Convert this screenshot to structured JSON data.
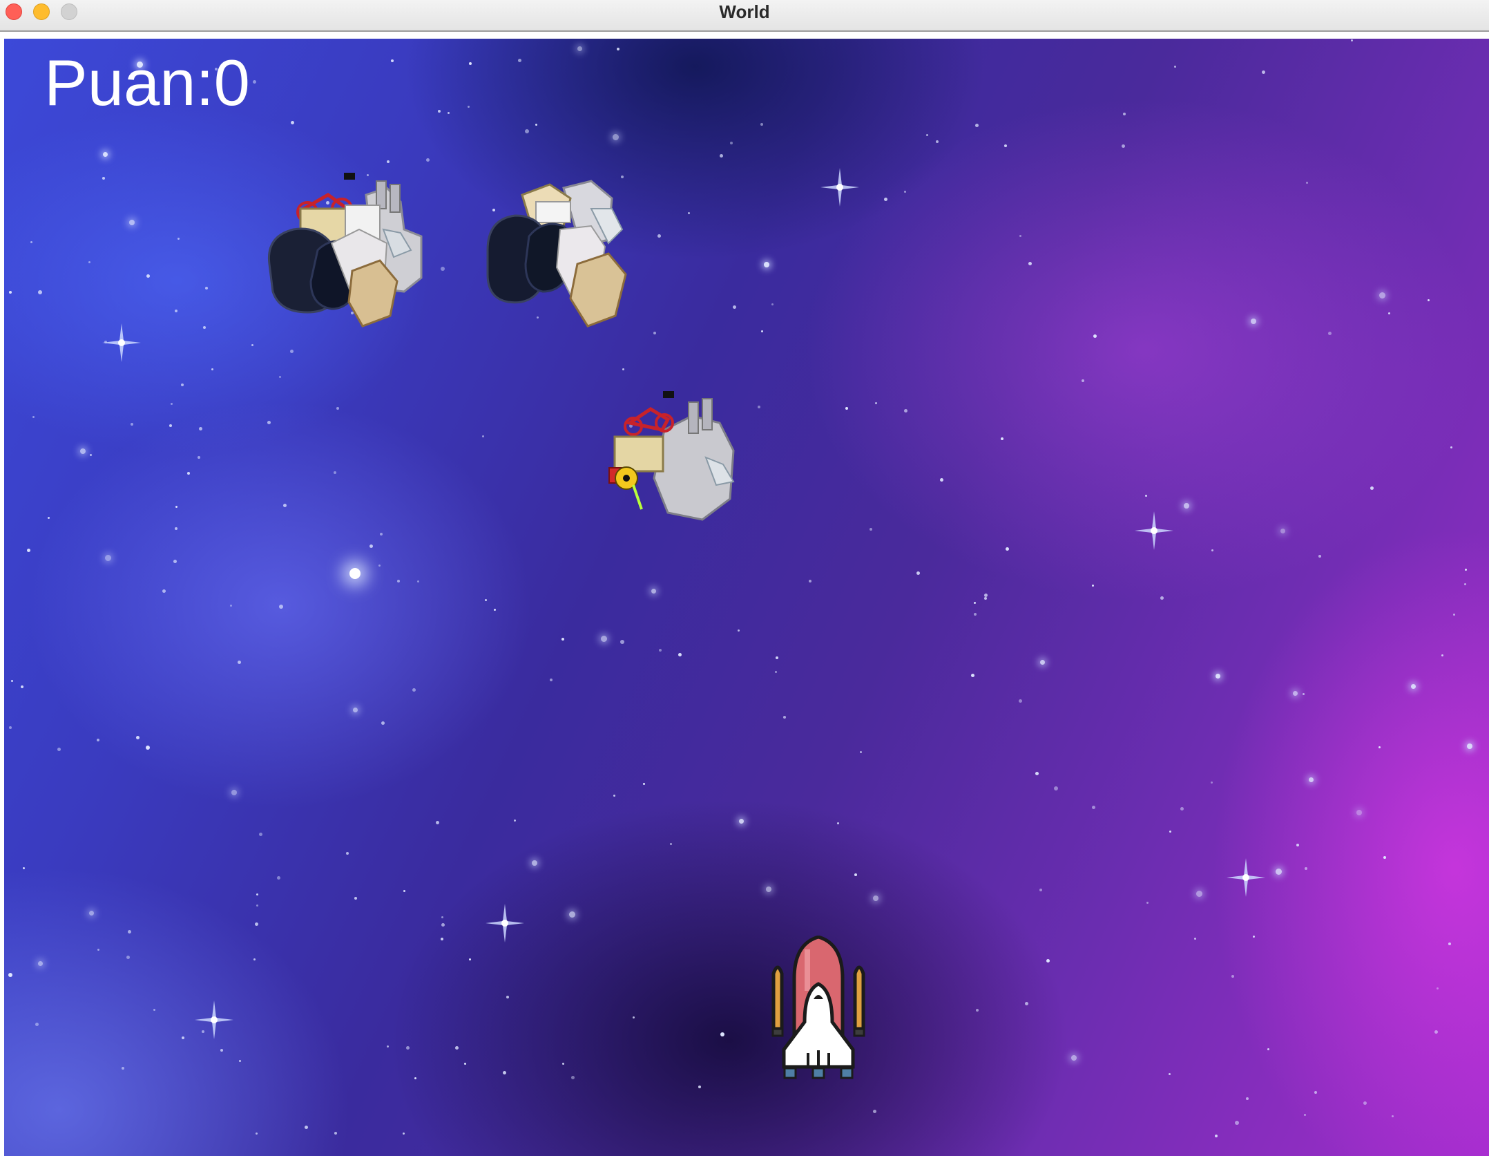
{
  "window": {
    "title": "World"
  },
  "hud": {
    "score_text": "Puan:0",
    "score_label": "Puan",
    "score_value": 0
  },
  "sprites": {
    "debris_icon": "space-debris-icon",
    "player_icon": "space-shuttle-icon",
    "debris_count": 3
  },
  "colors": {
    "score_text": "#ffffff",
    "shuttle_tank": "#d9676f",
    "shuttle_boosters": "#e0a040",
    "shuttle_body": "#ffffff"
  }
}
